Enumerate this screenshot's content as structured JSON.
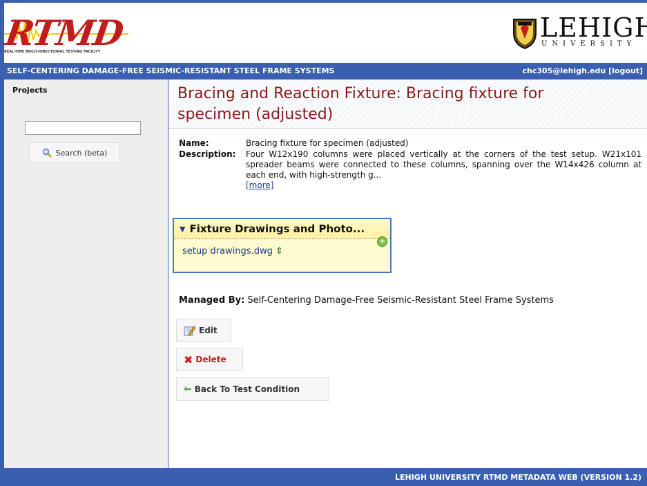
{
  "header": {
    "logo_text": "RTMD",
    "logo_subtitle": "REAL-TIME MULTI-DIRECTIONAL TESTING FACILITY",
    "university_name": "LEHIGH",
    "university_sub": "UNIVERSITY"
  },
  "navbar": {
    "project_name": "SELF-CENTERING DAMAGE-FREE SEISMIC-RESISTANT STEEL FRAME SYSTEMS",
    "user_email": "chc305@lehigh.edu",
    "logout_label": "[logout]"
  },
  "sidebar": {
    "heading": "Projects",
    "search_value": "",
    "search_button": "Search (beta)"
  },
  "page": {
    "title": "Bracing and Reaction Fixture: Bracing fixture for specimen (adjusted)"
  },
  "details": {
    "name_label": "Name:",
    "name_value": "Bracing fixture for specimen (adjusted)",
    "description_label": "Description:",
    "description_value": "Four W12x190 columns were placed vertically at the corners of the test setup. W21x101 spreader beams were connected to these columns, spanning over the W14x426 column at each end, with high-strength g...",
    "more_label": "[more]"
  },
  "fixture_panel": {
    "title": "Fixture Drawings and Photo...",
    "files": [
      "setup drawings.dwg"
    ]
  },
  "managed": {
    "label": "Managed By:",
    "value": "Self-Centering Damage-Free Seismic-Resistant Steel Frame Systems"
  },
  "actions": {
    "edit": "Edit",
    "delete": "Delete",
    "back": "Back To Test Condition"
  },
  "footer": {
    "text": "LEHIGH UNIVERSITY RTMD METADATA WEB (VERSION 1.2)"
  },
  "colors": {
    "accent_blue": "#3a5fb0",
    "title_red": "#8b1a1a",
    "logo_red": "#c41c1c"
  }
}
